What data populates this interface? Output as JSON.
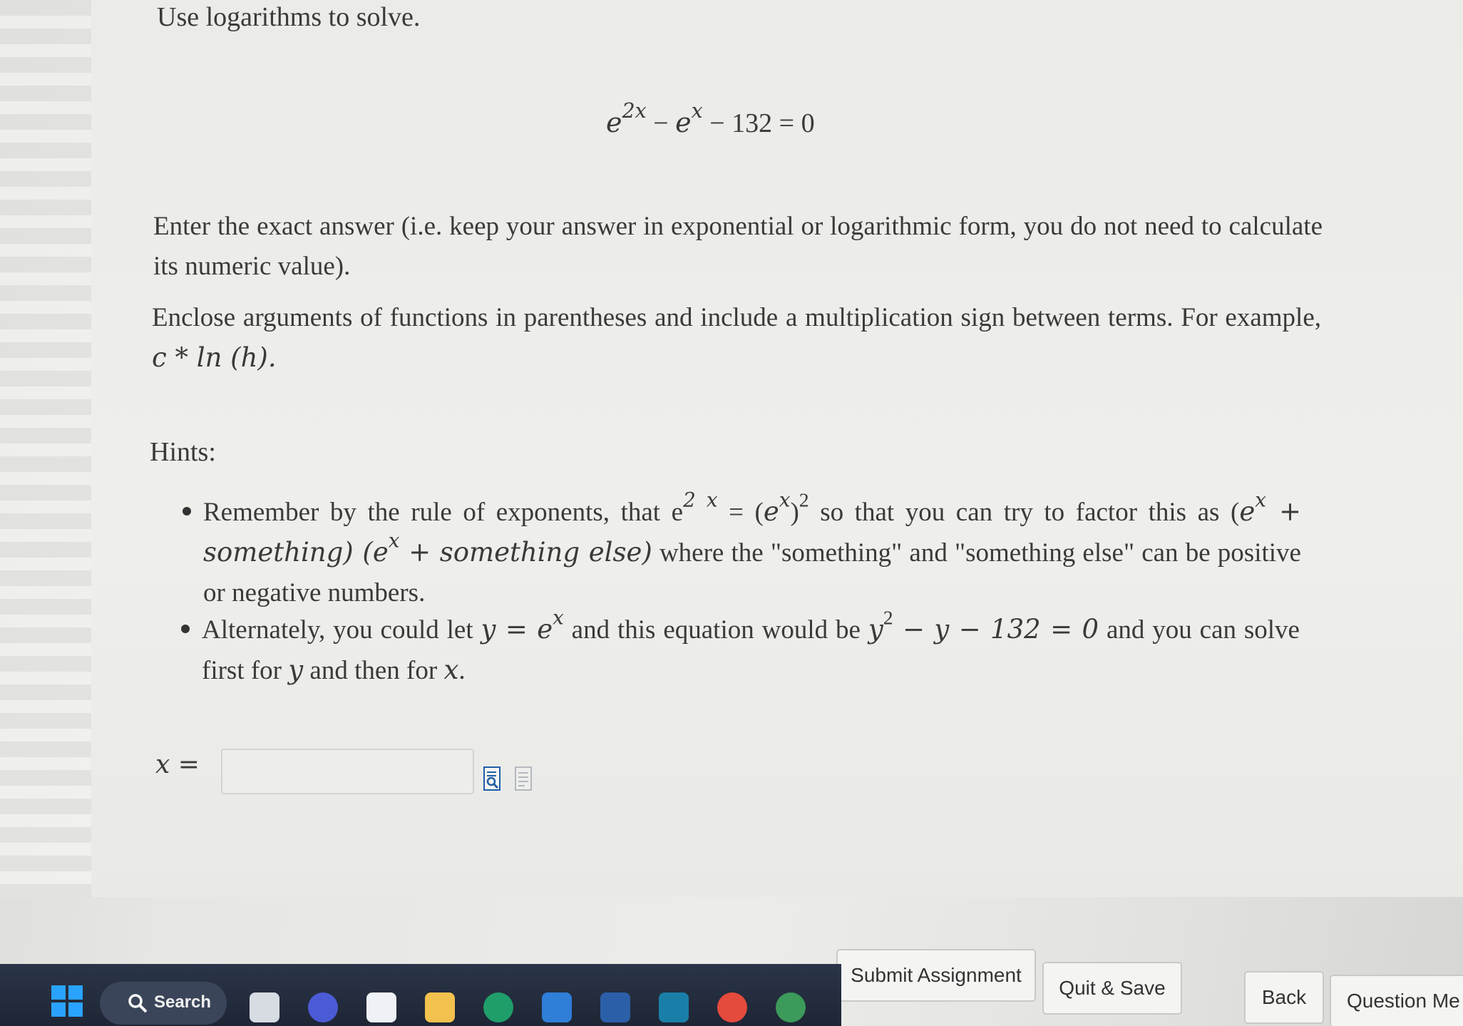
{
  "question": {
    "instruction": "Use logarithms to solve.",
    "equation": {
      "term1_base": "e",
      "term1_exp": "2x",
      "minus1": " − ",
      "term2_base": "e",
      "term2_exp": "x",
      "rest": " − 132 = 0"
    },
    "para_exact": "Enter the exact answer (i.e. keep your answer in exponential or logarithmic form, you do not need to calculate its numeric value).",
    "para_enclose_text": "Enclose arguments of functions in parentheses and include a multiplication sign between terms. For example, ",
    "para_enclose_example": "c * ln (h).",
    "hints_heading": "Hints:",
    "hint1": {
      "a": "Remember by the rule of exponents, that ",
      "b_base": "e",
      "b_exp": "2 x",
      "c": " = (",
      "d_base": "e",
      "d_exp": "x",
      "e_close": ")",
      "e_exp": "2",
      "f": " so that you can try to factor this as ",
      "g": "(",
      "h_base": "e",
      "h_exp": "x",
      "i": " + something) (",
      "j_base": "e",
      "j_exp": "x",
      "k": " + something else)",
      "l": " where the \"something\" and \"something else\" can be positive or negative numbers."
    },
    "hint2": {
      "a": "Alternately, you could let ",
      "b": "y = ",
      "c_base": "e",
      "c_exp": "x",
      "d": " and this equation would be ",
      "e_base": "y",
      "e_exp": "2",
      "f": " − y − 132 = 0",
      "g": " and you can solve first for ",
      "h": "y",
      "i": " and then for ",
      "j": "x",
      "k": "."
    },
    "answer_label": "x =",
    "answer_value": ""
  },
  "actions": {
    "submit": "Submit Assignment",
    "quit_save": "Quit & Save",
    "back": "Back",
    "question_menu": "Question Me"
  },
  "taskbar": {
    "search_label": "Search"
  },
  "icons": {
    "preview": "preview-answer-icon",
    "help": "help-document-icon",
    "start": "windows-start-icon",
    "search": "search-icon"
  },
  "colors": {
    "page_bg": "#e7e7e4",
    "text": "#3a3a3a",
    "taskbar": "#1e2635",
    "start_blue": "#2aa3ff"
  }
}
